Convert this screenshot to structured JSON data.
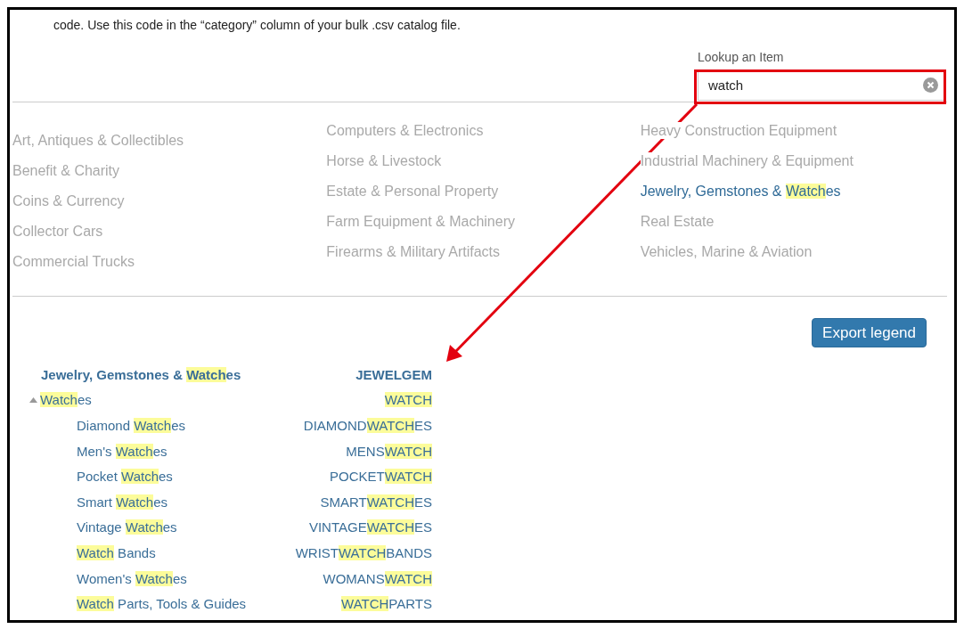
{
  "intro": "code. Use this code in the “category” column of your bulk .csv catalog file.",
  "lookup": {
    "label": "Lookup an Item",
    "value": "watch"
  },
  "category_columns": [
    {
      "items": [
        {
          "matched": false,
          "parts": [
            {
              "text": "Art, Antiques & Collectibles",
              "highlight": false
            }
          ]
        },
        {
          "matched": false,
          "parts": [
            {
              "text": "Benefit & Charity",
              "highlight": false
            }
          ]
        },
        {
          "matched": false,
          "parts": [
            {
              "text": "Coins & Currency",
              "highlight": false
            }
          ]
        },
        {
          "matched": false,
          "parts": [
            {
              "text": "Collector Cars",
              "highlight": false
            }
          ]
        },
        {
          "matched": false,
          "parts": [
            {
              "text": "Commercial Trucks",
              "highlight": false
            }
          ]
        }
      ]
    },
    {
      "items": [
        {
          "matched": false,
          "parts": [
            {
              "text": "Computers & Electronics",
              "highlight": false
            }
          ]
        },
        {
          "matched": false,
          "parts": [
            {
              "text": "Horse & Livestock",
              "highlight": false
            }
          ]
        },
        {
          "matched": false,
          "parts": [
            {
              "text": "Estate & Personal Property",
              "highlight": false
            }
          ]
        },
        {
          "matched": false,
          "parts": [
            {
              "text": "Farm Equipment & Machinery",
              "highlight": false
            }
          ]
        },
        {
          "matched": false,
          "parts": [
            {
              "text": "Firearms & Military Artifacts",
              "highlight": false
            }
          ]
        }
      ]
    },
    {
      "items": [
        {
          "matched": false,
          "parts": [
            {
              "text": "Heavy Construction Equipment",
              "highlight": false
            }
          ]
        },
        {
          "matched": false,
          "parts": [
            {
              "text": "Industrial Machinery & Equipment",
              "highlight": false
            }
          ]
        },
        {
          "matched": true,
          "parts": [
            {
              "text": "Jewelry, Gemstones & ",
              "highlight": false
            },
            {
              "text": "Watch",
              "highlight": true
            },
            {
              "text": "es",
              "highlight": false
            }
          ]
        },
        {
          "matched": false,
          "parts": [
            {
              "text": "Real Estate",
              "highlight": false
            }
          ]
        },
        {
          "matched": false,
          "parts": [
            {
              "text": "Vehicles, Marine & Aviation",
              "highlight": false
            }
          ]
        }
      ]
    }
  ],
  "export_button": "Export legend",
  "legend": {
    "name": [
      {
        "text": "Jewelry, Gemstones & ",
        "highlight": false
      },
      {
        "text": "Watch",
        "highlight": true
      },
      {
        "text": "es",
        "highlight": false
      }
    ],
    "code": [
      {
        "text": "JEWELGEM",
        "highlight": false
      }
    ],
    "children": [
      {
        "expanded": true,
        "name": [
          {
            "text": "Watch",
            "highlight": true
          },
          {
            "text": "es",
            "highlight": false
          }
        ],
        "code": [
          {
            "text": "WATCH",
            "highlight": true
          }
        ],
        "children": [
          {
            "name": [
              {
                "text": "Diamond ",
                "highlight": false
              },
              {
                "text": "Watch",
                "highlight": true
              },
              {
                "text": "es",
                "highlight": false
              }
            ],
            "code": [
              {
                "text": "DIAMOND",
                "highlight": false
              },
              {
                "text": "WATCH",
                "highlight": true
              },
              {
                "text": "ES",
                "highlight": false
              }
            ]
          },
          {
            "name": [
              {
                "text": "Men's ",
                "highlight": false
              },
              {
                "text": "Watch",
                "highlight": true
              },
              {
                "text": "es",
                "highlight": false
              }
            ],
            "code": [
              {
                "text": "MENS",
                "highlight": false
              },
              {
                "text": "WATCH",
                "highlight": true
              }
            ]
          },
          {
            "name": [
              {
                "text": "Pocket ",
                "highlight": false
              },
              {
                "text": "Watch",
                "highlight": true
              },
              {
                "text": "es",
                "highlight": false
              }
            ],
            "code": [
              {
                "text": "POCKET",
                "highlight": false
              },
              {
                "text": "WATCH",
                "highlight": true
              }
            ]
          },
          {
            "name": [
              {
                "text": "Smart ",
                "highlight": false
              },
              {
                "text": "Watch",
                "highlight": true
              },
              {
                "text": "es",
                "highlight": false
              }
            ],
            "code": [
              {
                "text": "SMART",
                "highlight": false
              },
              {
                "text": "WATCH",
                "highlight": true
              },
              {
                "text": "ES",
                "highlight": false
              }
            ]
          },
          {
            "name": [
              {
                "text": "Vintage ",
                "highlight": false
              },
              {
                "text": "Watch",
                "highlight": true
              },
              {
                "text": "es",
                "highlight": false
              }
            ],
            "code": [
              {
                "text": "VINTAGE",
                "highlight": false
              },
              {
                "text": "WATCH",
                "highlight": true
              },
              {
                "text": "ES",
                "highlight": false
              }
            ]
          },
          {
            "name": [
              {
                "text": "Watch",
                "highlight": true
              },
              {
                "text": " Bands",
                "highlight": false
              }
            ],
            "code": [
              {
                "text": "WRIST",
                "highlight": false
              },
              {
                "text": "WATCH",
                "highlight": true
              },
              {
                "text": "BANDS",
                "highlight": false
              }
            ]
          },
          {
            "name": [
              {
                "text": "Women's ",
                "highlight": false
              },
              {
                "text": "Watch",
                "highlight": true
              },
              {
                "text": "es",
                "highlight": false
              }
            ],
            "code": [
              {
                "text": "WOMANS",
                "highlight": false
              },
              {
                "text": "WATCH",
                "highlight": true
              }
            ]
          },
          {
            "name": [
              {
                "text": "Watch",
                "highlight": true
              },
              {
                "text": " Parts, Tools & Guides",
                "highlight": false
              }
            ],
            "code": [
              {
                "text": "WATCH",
                "highlight": true
              },
              {
                "text": "PARTS",
                "highlight": false
              }
            ]
          }
        ]
      }
    ]
  }
}
